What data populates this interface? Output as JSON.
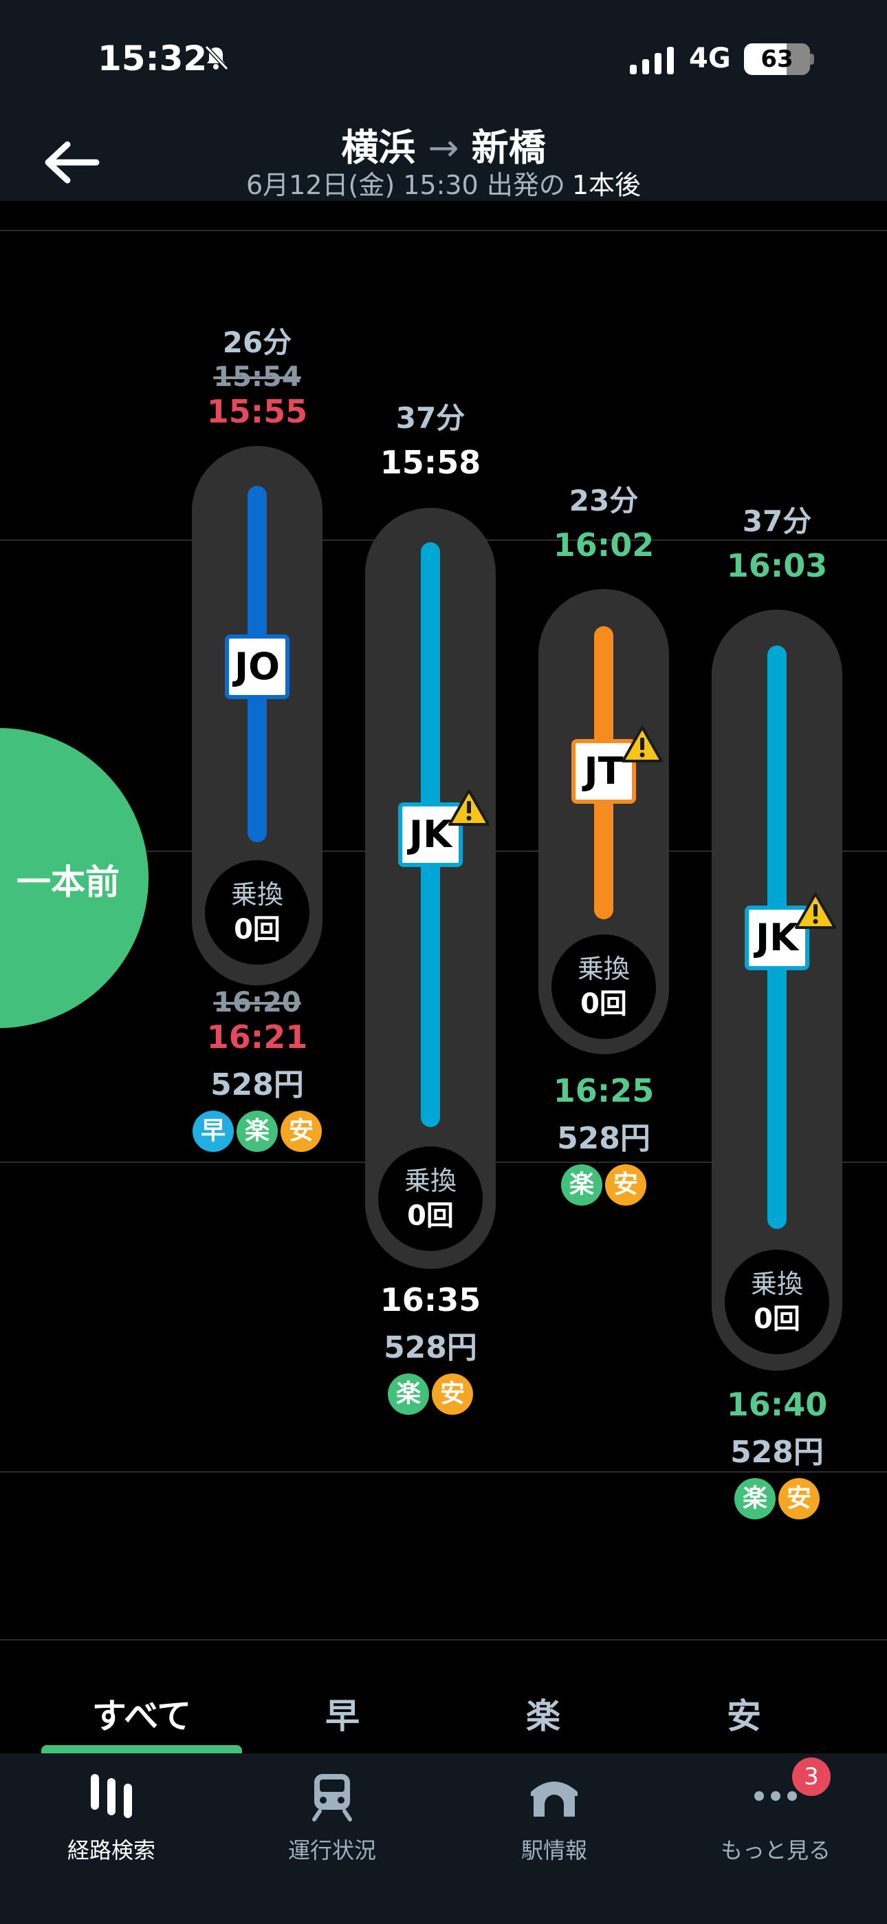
{
  "status_bar": {
    "time": "15:32",
    "network": "4G",
    "battery": "63"
  },
  "header": {
    "from": "横浜",
    "to": "新橋",
    "subtitle": "6月12日(金) 15:30 出発の",
    "shift": "1本後"
  },
  "prev_button": {
    "label": "一本前"
  },
  "routes": [
    {
      "duration": "26分",
      "dep_scheduled": "15:54",
      "dep": "15:55",
      "line": "JO",
      "line_color": "#0a6ccf",
      "warning": false,
      "transfer_label": "乗換",
      "transfer_count": "0回",
      "arr_scheduled": "16:20",
      "arr": "16:21",
      "price": "528円",
      "tags": [
        "早",
        "楽",
        "安"
      ]
    },
    {
      "duration": "37分",
      "dep": "15:58",
      "line": "JK",
      "line_color": "#00a7d4",
      "warning": true,
      "transfer_label": "乗換",
      "transfer_count": "0回",
      "arr": "16:35",
      "price": "528円",
      "tags": [
        "楽",
        "安"
      ]
    },
    {
      "duration": "23分",
      "dep": "16:02",
      "line": "JT",
      "line_color": "#f68b1f",
      "warning": true,
      "transfer_label": "乗換",
      "transfer_count": "0回",
      "arr": "16:25",
      "price": "528円",
      "tags": [
        "楽",
        "安"
      ]
    },
    {
      "duration": "37分",
      "dep": "16:03",
      "line": "JK",
      "line_color": "#00a7d4",
      "warning": true,
      "transfer_label": "乗換",
      "transfer_count": "0回",
      "arr": "16:40",
      "price": "528円",
      "tags": [
        "楽",
        "安"
      ]
    }
  ],
  "filter_tabs": [
    "すべて",
    "早",
    "楽",
    "安"
  ],
  "bottom_nav": {
    "items": [
      "経路検索",
      "運行状況",
      "駅情報",
      "もっと見る"
    ],
    "badge": "3"
  },
  "colors": {
    "accent": "#43c07a",
    "delay": "#e6485c",
    "early": "#56c98c"
  }
}
